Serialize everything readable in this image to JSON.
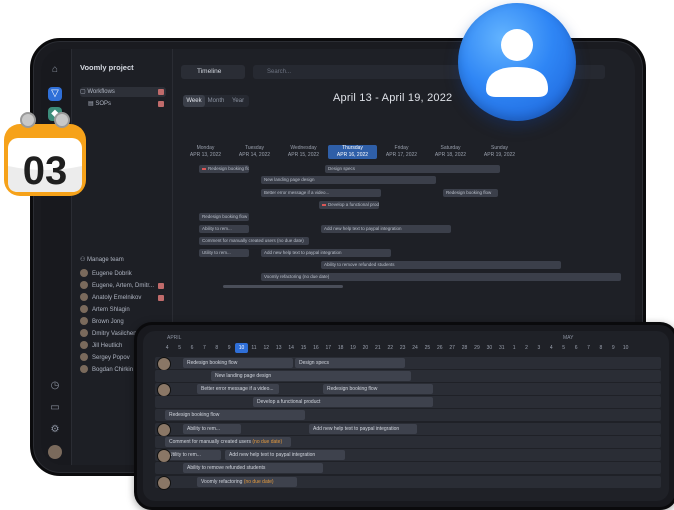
{
  "sidebar": {
    "project": "Voomly project",
    "items": [
      {
        "label": "Workflows"
      },
      {
        "label": "SOPs"
      }
    ],
    "manage_team": "Manage team",
    "members": [
      "Eugene Dobrik",
      "Eugene, Artem, Dmitr...",
      "Anatoly Emelnikov",
      "Artem Shlagin",
      "Brown Jong",
      "Dmitry Vasilchen",
      "Jill Heutlich",
      "Sergey Popov",
      "Bogdan Chirkin"
    ]
  },
  "toolbar": {
    "view_select": "Timeline",
    "search_placeholder": "Search..."
  },
  "view_tabs": [
    "Week",
    "Month",
    "Year"
  ],
  "date_range": "April 13 - April 19, 2022",
  "week_days": [
    {
      "name": "Monday",
      "date": "APR 13, 2022"
    },
    {
      "name": "Tuesday",
      "date": "APR 14, 2022"
    },
    {
      "name": "Wednesday",
      "date": "APR 15, 2022"
    },
    {
      "name": "Thursday",
      "date": "APR 16, 2022"
    },
    {
      "name": "Friday",
      "date": "APR 17, 2022"
    },
    {
      "name": "Saturday",
      "date": "APR 18, 2022"
    },
    {
      "name": "Sunday",
      "date": "APR 19, 2022"
    }
  ],
  "week_bars": [
    "Redesign booking flow",
    "Design specs",
    "New landing page design",
    "Better error message if a video...",
    "Redesign booking flow",
    "Develop a functional product",
    "Redesign booking flow",
    "Ability to rem...",
    "Add new help text to paypal integration",
    "Comment for manually created users (no due date)",
    "Utility to rem...",
    "Add new help text to paypal integration",
    "Ability to remove refunded students",
    "Voomly refactoring (no due date)"
  ],
  "tablet": {
    "month_april": "APRIL",
    "month_may": "MAY",
    "days": [
      "4",
      "5",
      "6",
      "7",
      "8",
      "9",
      "10",
      "11",
      "12",
      "13",
      "14",
      "15",
      "16",
      "17",
      "18",
      "19",
      "20",
      "21",
      "22",
      "23",
      "24",
      "25",
      "26",
      "27",
      "28",
      "29",
      "30",
      "31",
      "1",
      "2",
      "3",
      "4",
      "5",
      "6",
      "7",
      "8",
      "9",
      "10"
    ],
    "today": "10",
    "bars": {
      "redesign1": "Redesign booking flow",
      "design_specs": "Design specs",
      "landing": "New landing page design",
      "better_error": "Better error message if a video...",
      "redesign2": "Redesign booking flow",
      "develop": "Develop a functional product",
      "redesign3": "Redesign booking flow",
      "ability": "Ability to rem...",
      "help1": "Add new help text to paypal integration",
      "comment": "Comment for manually created users",
      "no_due": "(no due date)",
      "utility": "Utility to rem...",
      "help2": "Add new help text to paypal integration",
      "refunded": "Ability to remove refunded students",
      "refactor": "Voomly refactoring"
    }
  },
  "calendar_icon": {
    "day": "03",
    "icon": "calendar-icon"
  },
  "user_icon": "user-icon",
  "colors": {
    "accent": "#2f6fd8",
    "badge_blue": "#2f86f5",
    "calendar_orange": "#f6a21a",
    "red_marker": "#c06b6b"
  }
}
